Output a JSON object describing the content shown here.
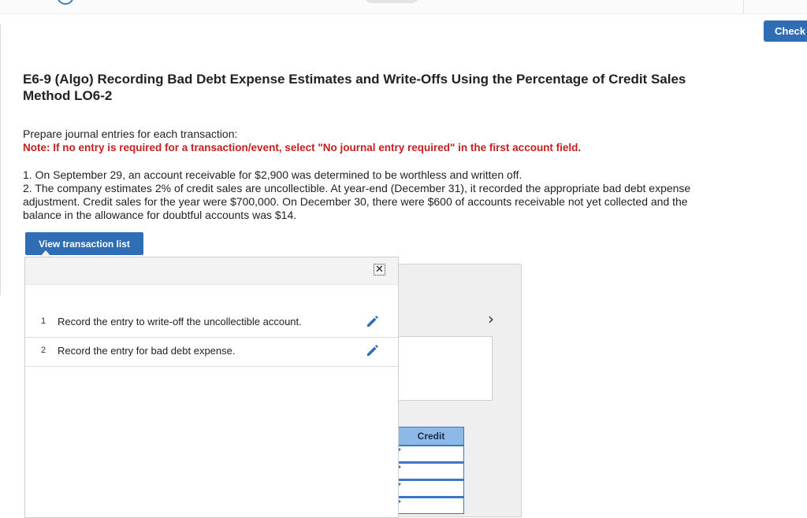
{
  "header": {
    "check_label": "Check"
  },
  "question": {
    "title": "E6-9 (Algo) Recording Bad Debt Expense Estimates and Write-Offs Using the Percentage of Credit Sales Method LO6-2",
    "instruction": "Prepare journal entries for each transaction:",
    "note": "Note: If no entry is required for a transaction/event, select \"No journal entry required\" in the first account field.",
    "items": [
      "1. On September 29, an account receivable for $2,900 was determined to be worthless and written off.",
      "2. The company estimates 2% of credit sales are uncollectible. At year-end (December 31), it recorded the appropriate bad debt expense adjustment. Credit sales for the year were $700,000. On December 30, there were $600 of accounts receivable not yet collected and the balance in the allowance for doubtful accounts was $14."
    ]
  },
  "transaction_list": {
    "button_label": "View transaction list",
    "close_glyph": "✕",
    "rows": [
      {
        "num": "1",
        "label": "Record the entry to write-off the uncollectible account.",
        "icon": "pencil-icon"
      },
      {
        "num": "2",
        "label": "Record the entry for bad debt expense.",
        "icon": "pencil-icon"
      }
    ]
  },
  "journal": {
    "next_glyph": "›",
    "credit_header": "Credit",
    "credit_values": [
      "",
      "",
      "",
      ""
    ]
  },
  "colors": {
    "primary_button": "#2f6db5",
    "note_red": "#c42020",
    "pencil_blue": "#2f6db5",
    "credit_header_bg": "#8db9e8"
  }
}
